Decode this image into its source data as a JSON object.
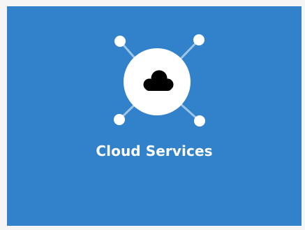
{
  "colors": {
    "page_background": "#f5f5f5",
    "tile_background": "#3282cb",
    "hub_circle": "#ffffff",
    "connector_lines": "#9cc4e6",
    "node_dots": "#ffffff",
    "cloud_glyph": "#000000",
    "title_text": "#ffffff"
  },
  "tile": {
    "title": "Cloud Services",
    "icon": "cloud-icon"
  }
}
